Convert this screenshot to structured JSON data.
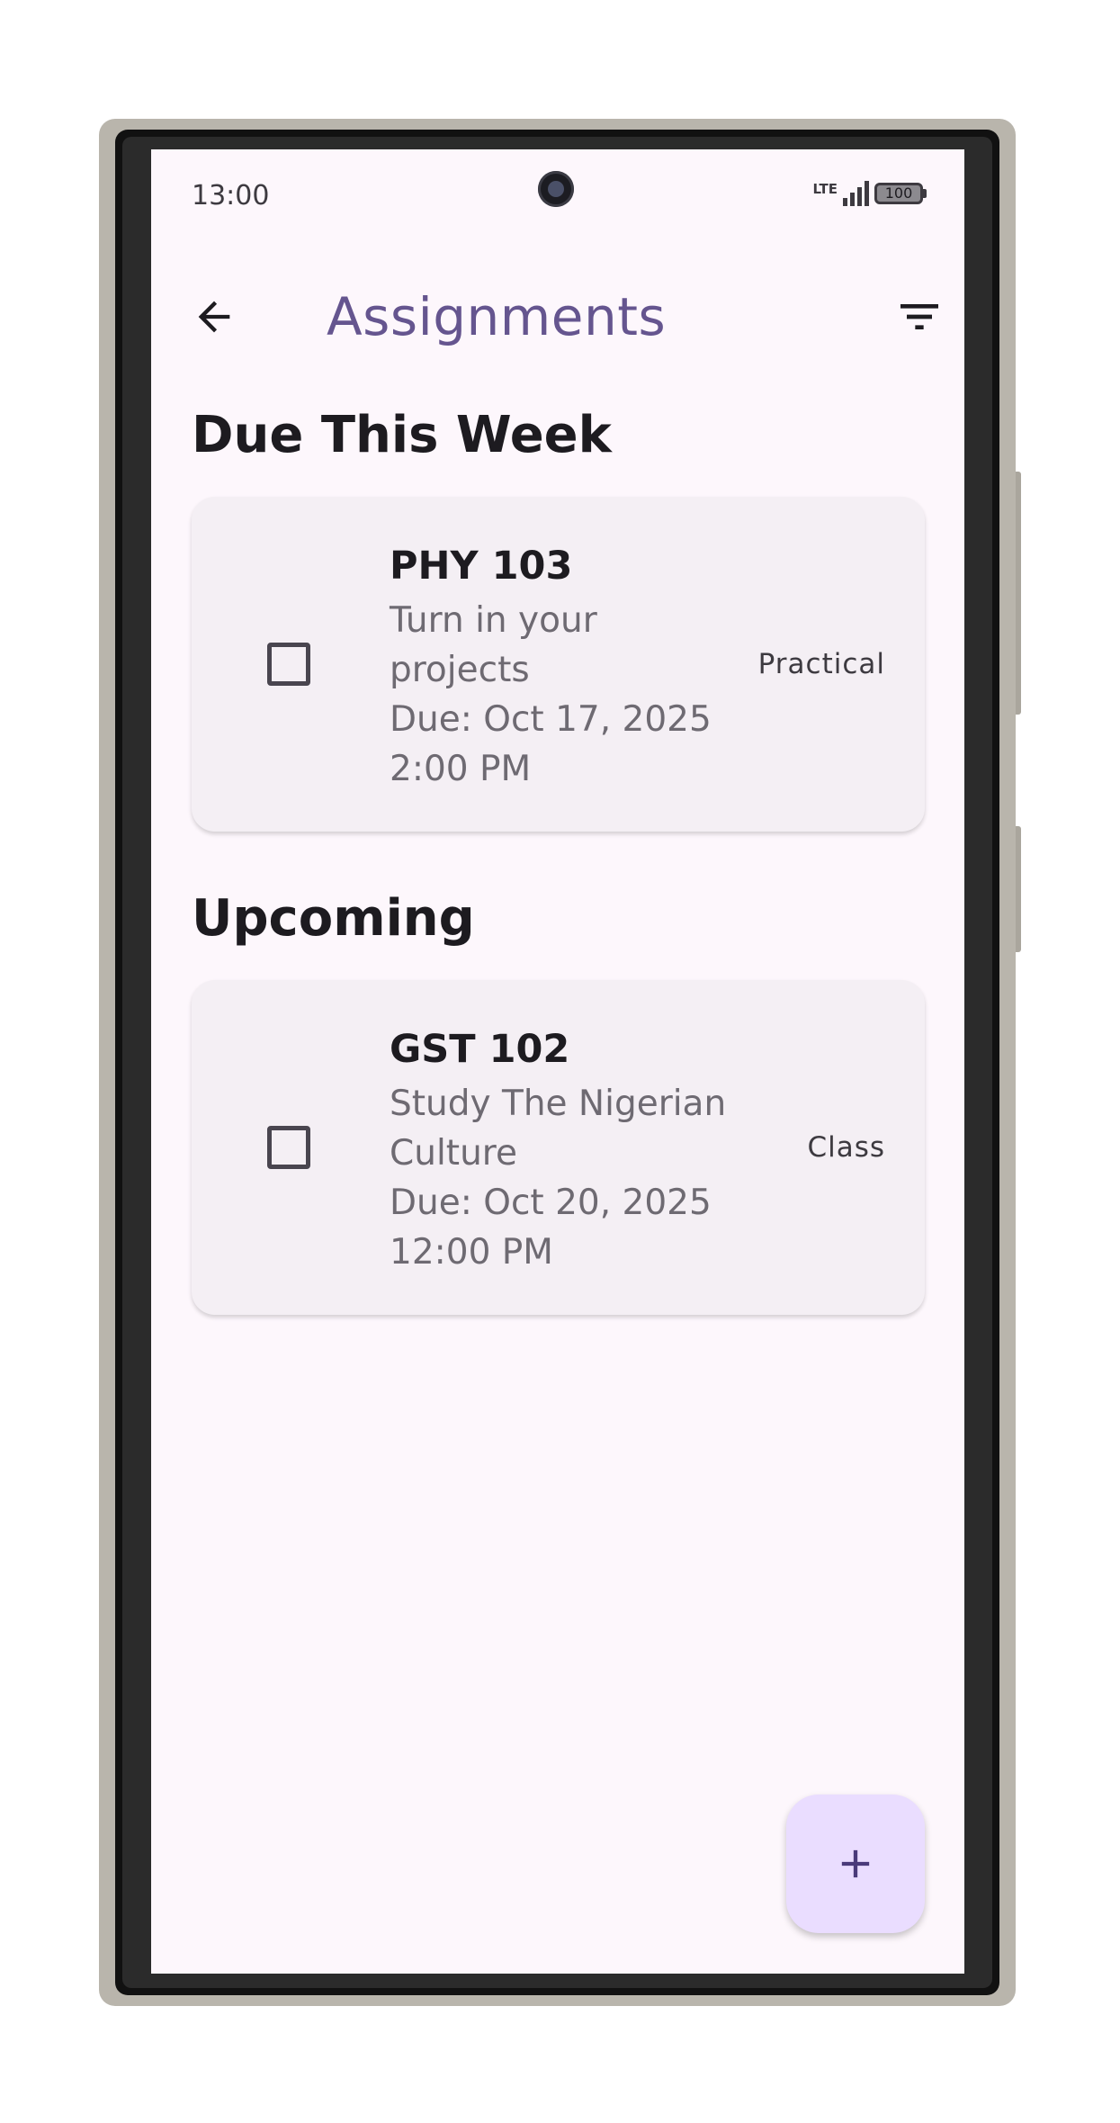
{
  "status_bar": {
    "time": "13:00",
    "network": "LTE",
    "battery": "100"
  },
  "app_bar": {
    "title": "Assignments",
    "back_icon": "arrow-left-icon",
    "filter_icon": "filter-list-icon"
  },
  "sections": [
    {
      "title": "Due This Week",
      "items": [
        {
          "code": "PHY 103",
          "description": "Turn in your projects",
          "due_date": "Due: Oct 17, 2025",
          "due_time": "2:00 PM",
          "type": "Practical",
          "checked": false
        }
      ]
    },
    {
      "title": "Upcoming",
      "items": [
        {
          "code": "GST 102",
          "description": "Study The Nigerian Culture",
          "due_date": "Due: Oct 20, 2025",
          "due_time": "12:00 PM",
          "type": "Class",
          "checked": false
        }
      ]
    }
  ],
  "fab": {
    "icon": "plus-icon"
  },
  "colors": {
    "accent": "#65558f",
    "background": "#fdf7fc",
    "card": "#f4eff4",
    "fab": "#eaddff"
  }
}
